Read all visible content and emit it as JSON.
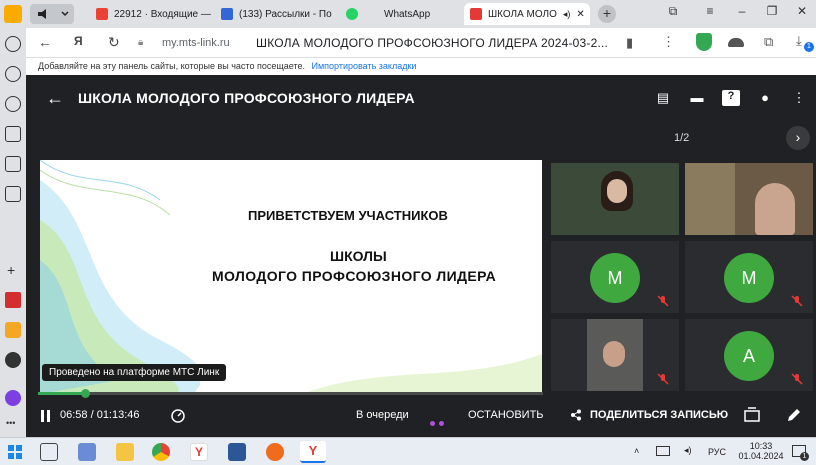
{
  "browser": {
    "tabs": [
      {
        "label": "22912 · Входящие —",
        "color": "#ea4335"
      },
      {
        "label": "(133) Рассылки - По",
        "color": "#3367d6"
      },
      {
        "label": "WhatsApp",
        "color": "#25d366"
      },
      {
        "label": "ШКОЛА МОЛО",
        "color": "#e53935"
      }
    ],
    "new_tab": "+",
    "url_domain": "my.mts-link.ru",
    "page_title": "ШКОЛА МОЛОДОГО ПРОФСОЮЗНОГО ЛИДЕРА 2024-03-2...",
    "bookmarks_text": "Добавляйте на эту панель сайты, которые вы часто посещаете.",
    "bookmarks_link": "Импортировать закладки",
    "download_badge": "1"
  },
  "app": {
    "title": "ШКОЛА МОЛОДОГО ПРОФСОЮЗНОГО ЛИДЕРА",
    "pager": "1/2",
    "slide": {
      "line1": "ПРИВЕТСТВУЕМ УЧАСТНИКОВ",
      "line2": "ШКОЛЫ",
      "line3": "МОЛОДОГО  ПРОФСОЮЗНОГО  ЛИДЕРА"
    },
    "participants": [
      {
        "type": "video"
      },
      {
        "type": "video"
      },
      {
        "type": "avatar",
        "initial": "М",
        "muted": true
      },
      {
        "type": "avatar",
        "initial": "М",
        "muted": true
      },
      {
        "type": "video",
        "muted": true
      },
      {
        "type": "avatar",
        "initial": "А",
        "muted": true
      }
    ],
    "provided_by": "Проведено на платформе МТС Линк",
    "playback": {
      "time": "06:58 / 01:13:46",
      "progress": 0.094
    },
    "queue_label": "В очереди",
    "stop_label": "ОСТАНОВИТЬ",
    "share_label": "ПОДЕЛИТЬСЯ ЗАПИСЬЮ"
  },
  "taskbar": {
    "lang": "РУС",
    "time": "10:33",
    "date": "01.04.2024",
    "notifications": "1"
  },
  "colors": {
    "avatar_green": "#3fa83f",
    "progress_green": "#34a853",
    "queue_dots": "#b14fe0"
  }
}
